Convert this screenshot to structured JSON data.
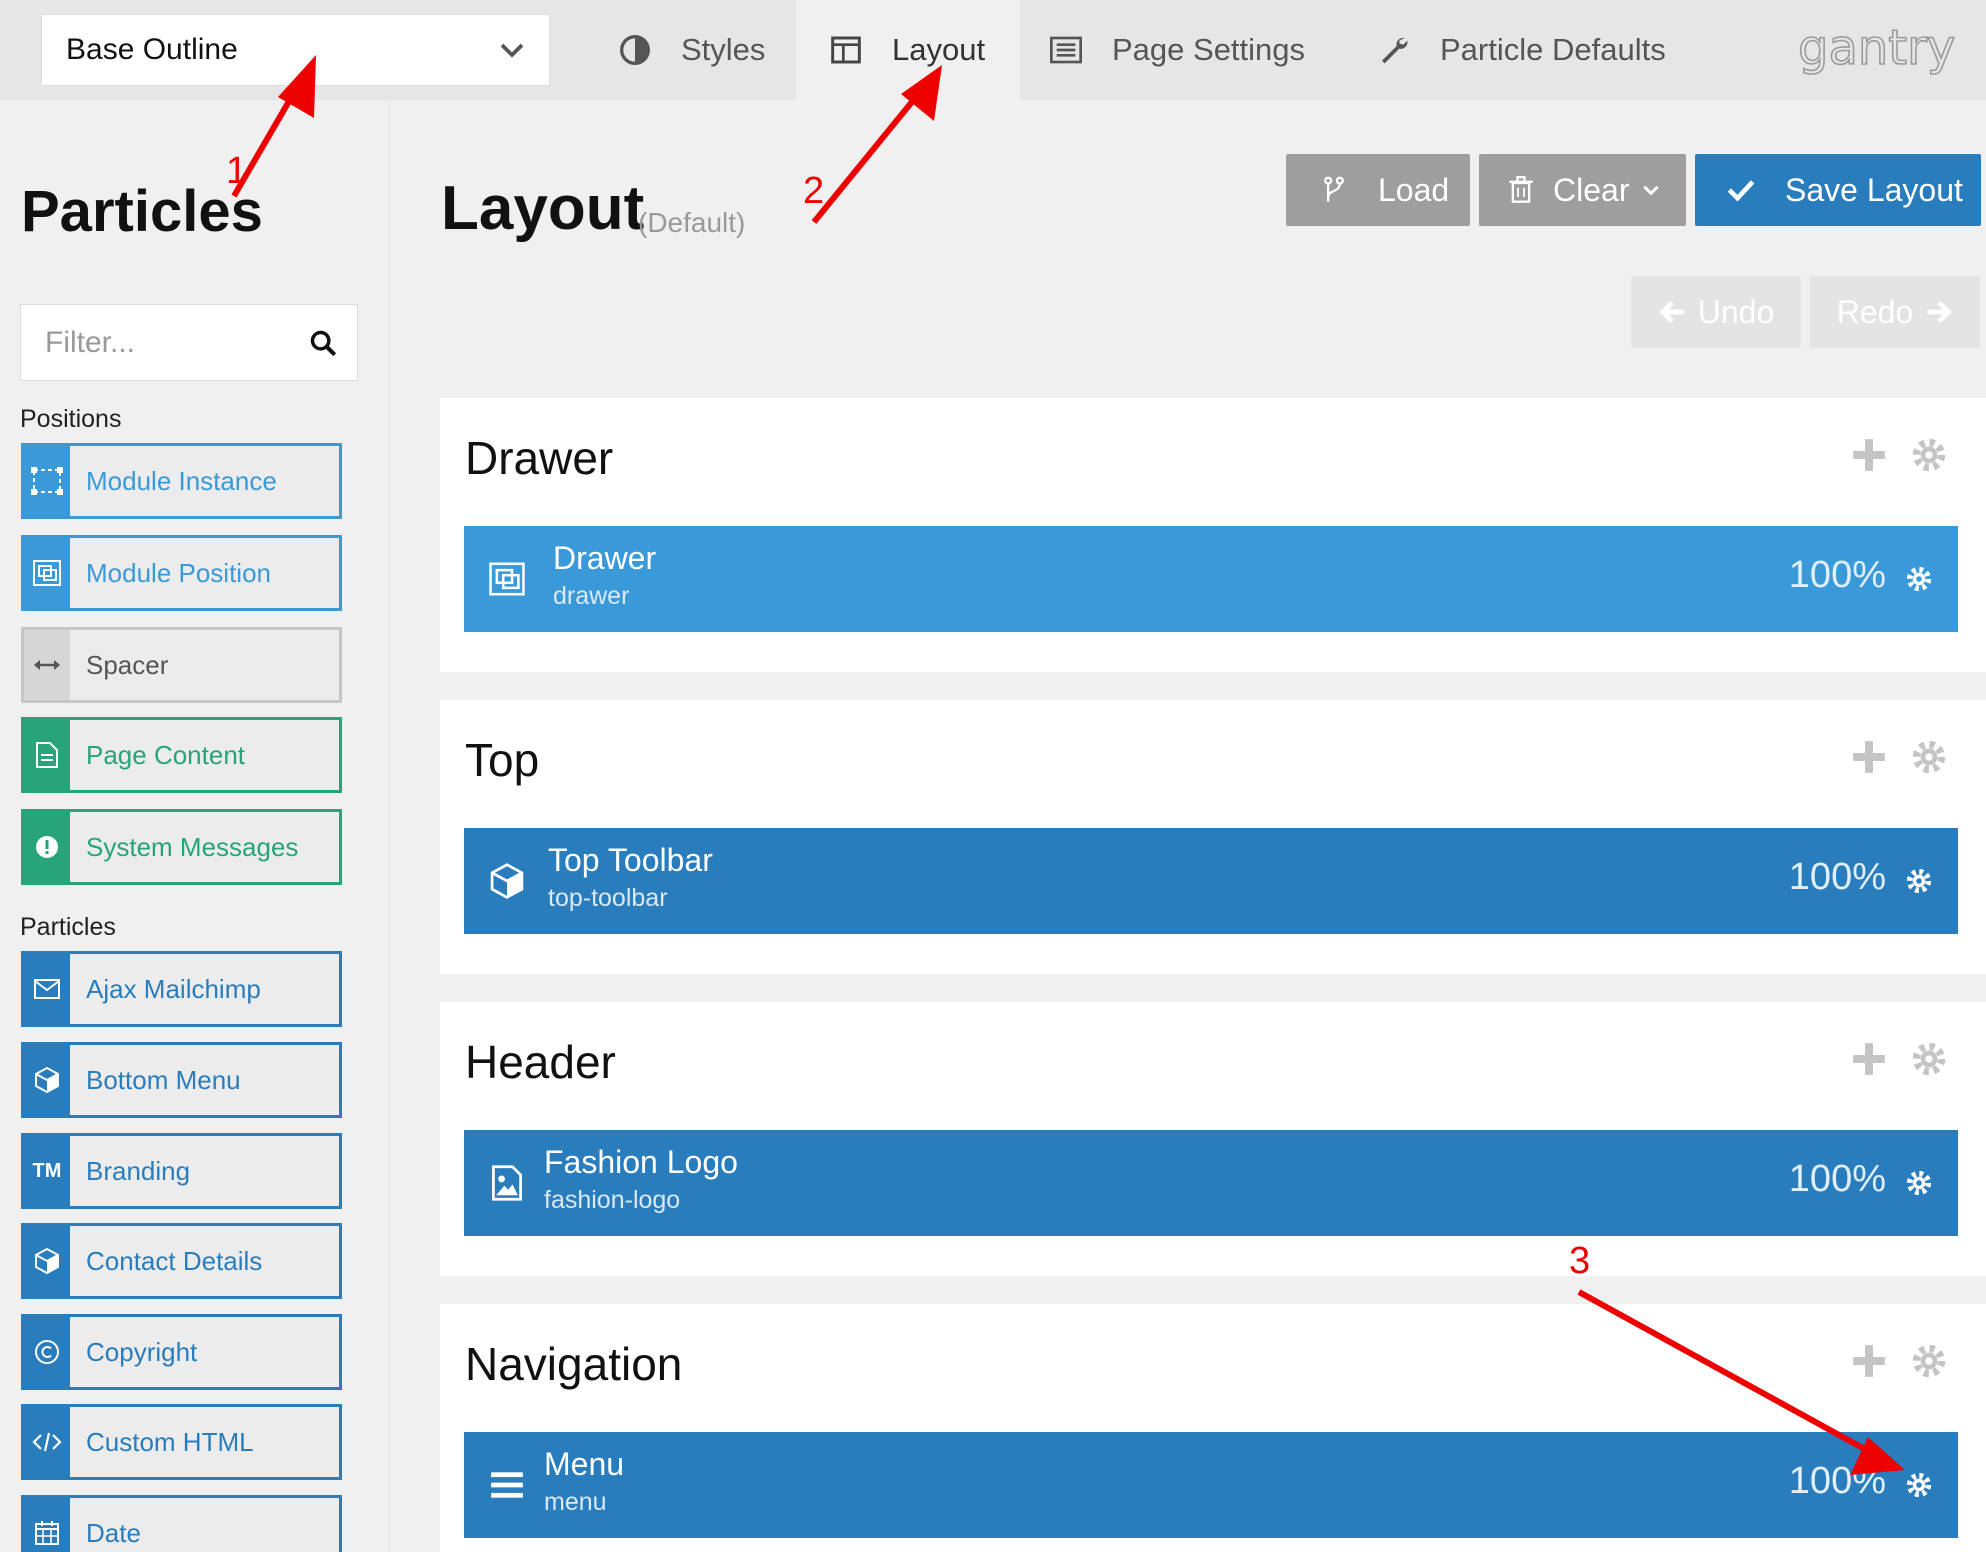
{
  "topbar": {
    "outline_select": "Base Outline",
    "tabs": [
      {
        "label": "Styles",
        "icon": "contrast-icon"
      },
      {
        "label": "Layout",
        "icon": "layout-columns-icon",
        "active": true
      },
      {
        "label": "Page Settings",
        "icon": "page-list-icon"
      },
      {
        "label": "Particle Defaults",
        "icon": "wrench-icon"
      }
    ],
    "brand": "gantry"
  },
  "sidebar": {
    "title": "Particles",
    "filter_placeholder": "Filter...",
    "positions_label": "Positions",
    "positions": [
      {
        "label": "Module Instance",
        "icon": "module-instance-icon",
        "color": "#3a9ad9"
      },
      {
        "label": "Module Position",
        "icon": "module-position-icon",
        "color": "#3a9ad9"
      },
      {
        "label": "Spacer",
        "icon": "spacer-arrows-icon",
        "color": "#c6c6c6"
      },
      {
        "label": "Page Content",
        "icon": "document-icon",
        "color": "#27a47a"
      },
      {
        "label": "System Messages",
        "icon": "alert-icon",
        "color": "#27a47a"
      }
    ],
    "particles_label": "Particles",
    "particles": [
      {
        "label": "Ajax Mailchimp",
        "icon": "envelope-icon"
      },
      {
        "label": "Bottom Menu",
        "icon": "cube-icon"
      },
      {
        "label": "Branding",
        "icon": "trademark-icon",
        "icon_text": "TM"
      },
      {
        "label": "Contact Details",
        "icon": "cube-icon"
      },
      {
        "label": "Copyright",
        "icon": "copyright-icon"
      },
      {
        "label": "Custom HTML",
        "icon": "code-icon"
      },
      {
        "label": "Date",
        "icon": "calendar-icon"
      }
    ]
  },
  "main": {
    "title": "Layout",
    "subtitle": "(Default)",
    "buttons": {
      "load": "Load",
      "clear": "Clear",
      "save": "Save Layout",
      "undo": "Undo",
      "redo": "Redo"
    },
    "sections": [
      {
        "title": "Drawer",
        "particle": {
          "name": "Drawer",
          "id": "drawer",
          "width": "100%",
          "icon": "module-position-icon"
        }
      },
      {
        "title": "Top",
        "particle": {
          "name": "Top Toolbar",
          "id": "top-toolbar",
          "width": "100%",
          "icon": "cube-icon"
        }
      },
      {
        "title": "Header",
        "particle": {
          "name": "Fashion Logo",
          "id": "fashion-logo",
          "width": "100%",
          "icon": "image-icon"
        }
      },
      {
        "title": "Navigation",
        "particle": {
          "name": "Menu",
          "id": "menu",
          "width": "100%",
          "icon": "hamburger-icon"
        }
      }
    ]
  },
  "annotations": [
    "1",
    "2",
    "3"
  ],
  "colors": {
    "primary": "#2a7dbd",
    "light_blue": "#3a9ad9",
    "green": "#27a47a",
    "gray_button": "#9e9e9e",
    "annotation_red": "#ee0000"
  }
}
